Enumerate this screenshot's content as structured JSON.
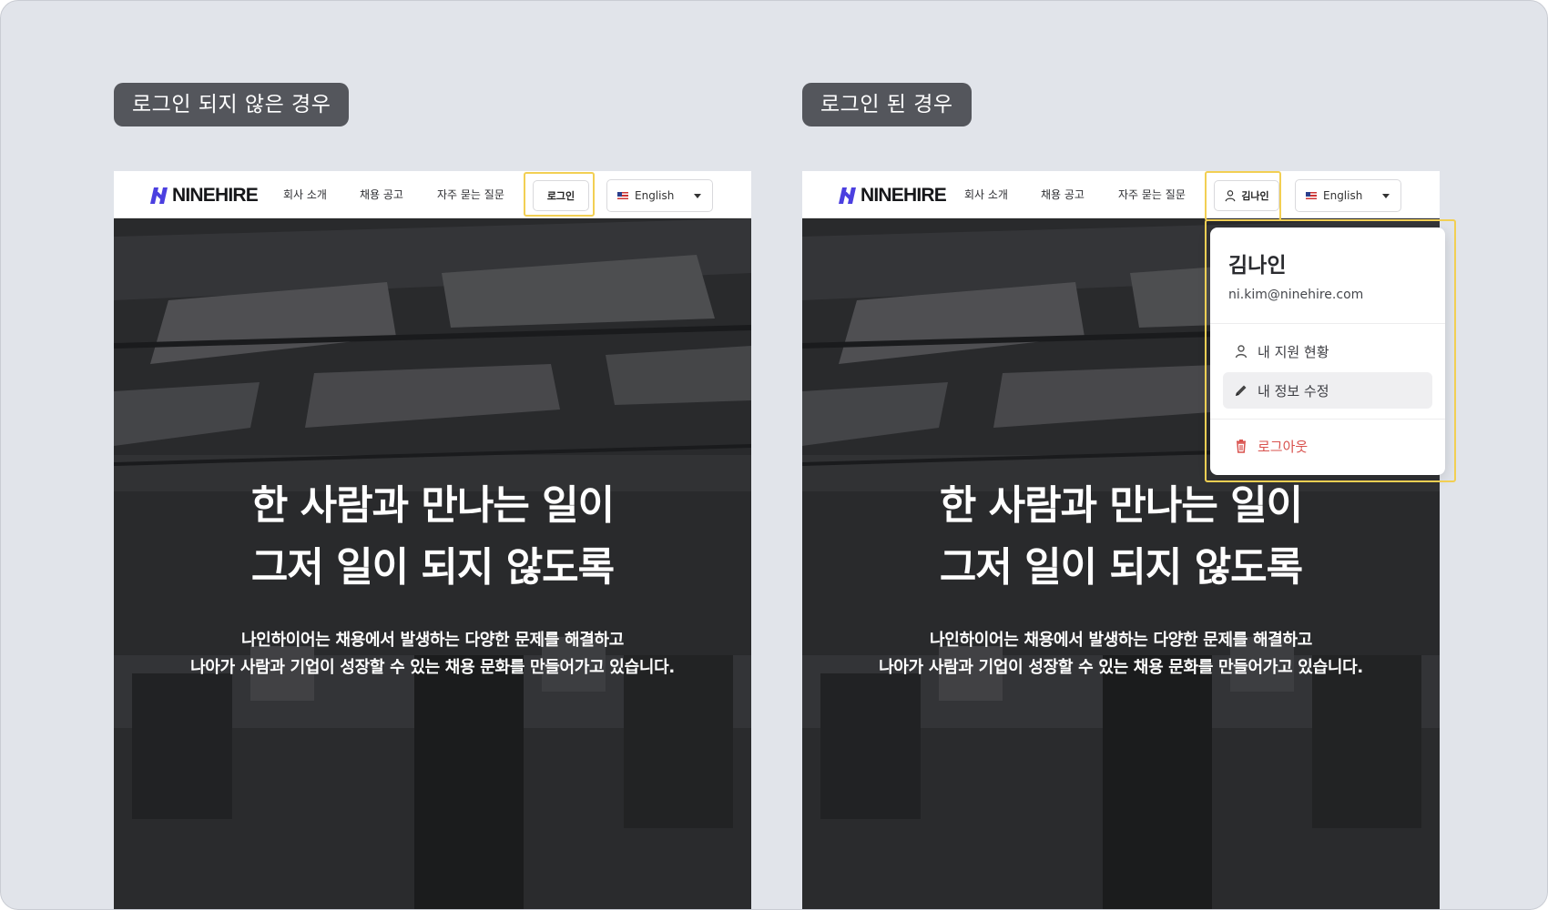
{
  "labels": {
    "logged_out": "로그인 되지 않은 경우",
    "logged_in": "로그인 된 경우"
  },
  "brand": {
    "name": "NINEHIRE",
    "accent": "#4b3fe0"
  },
  "nav": {
    "items": [
      "회사 소개",
      "채용 공고",
      "자주 묻는 질문"
    ],
    "login_label": "로그인",
    "user_label": "김나인",
    "language": "English"
  },
  "hero": {
    "title_line1": "한 사람과 만나는 일이",
    "title_line2": "그저 일이 되지 않도록",
    "sub_line1": "나인하이어는 채용에서 발생하는 다양한 문제를 해결하고",
    "sub_line2": "나아가 사람과 기업이 성장할 수 있는 채용 문화를 만들어가고 있습니다."
  },
  "user_menu": {
    "name": "김나인",
    "email": "ni.kim@ninehire.com",
    "items": [
      {
        "label": "내 지원 현황",
        "icon": "user-icon"
      },
      {
        "label": "내 정보 수정",
        "icon": "pencil-icon"
      },
      {
        "label": "로그아웃",
        "icon": "trash-icon"
      }
    ]
  },
  "colors": {
    "highlight": "#f2cf53",
    "logout": "#d9534f",
    "label_bg": "#54565c"
  }
}
